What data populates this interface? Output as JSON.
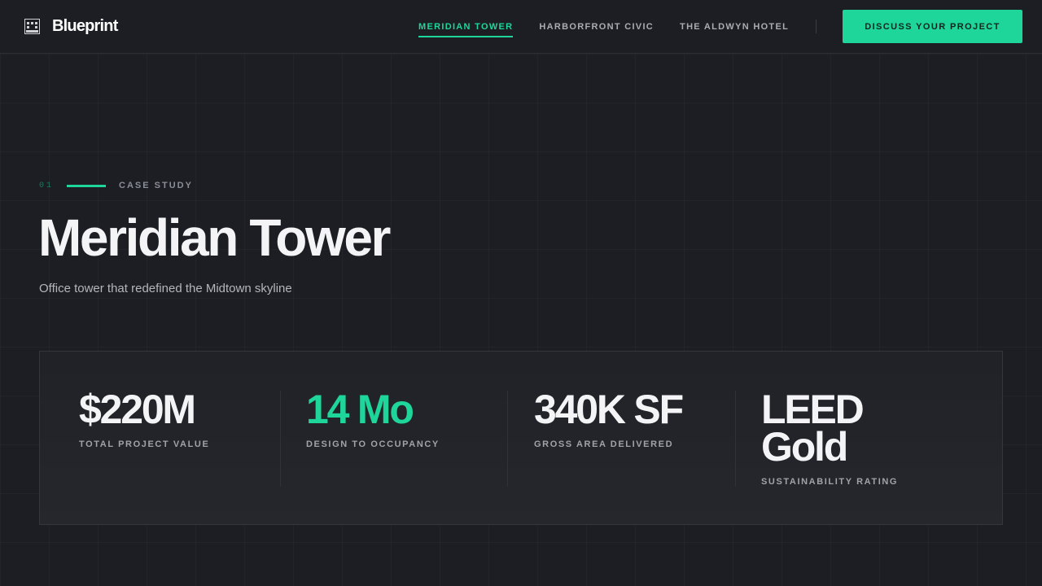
{
  "brand": {
    "name": "Blueprint",
    "icon": "building-icon"
  },
  "nav": {
    "items": [
      {
        "label": "MERIDIAN TOWER",
        "active": true
      },
      {
        "label": "HARBORFRONT CIVIC",
        "active": false
      },
      {
        "label": "THE ALDWYN HOTEL",
        "active": false
      }
    ],
    "cta_label": "DISCUSS YOUR PROJECT"
  },
  "hero": {
    "index": "01",
    "eyebrow": "CASE STUDY",
    "title": "Meridian Tower",
    "subtitle": "Office tower that redefined the Midtown skyline"
  },
  "stats": [
    {
      "value": "$220M",
      "label": "TOTAL PROJECT VALUE",
      "accent": false
    },
    {
      "value": "14 Mo",
      "label": "DESIGN TO OCCUPANCY",
      "accent": true
    },
    {
      "value": "340K SF",
      "label": "GROSS AREA DELIVERED",
      "accent": false
    },
    {
      "value": "LEED Gold",
      "label": "SUSTAINABILITY RATING",
      "accent": false
    }
  ],
  "colors": {
    "accent": "#1ed69a",
    "background": "#1c1e23",
    "panel": "#23252a"
  }
}
